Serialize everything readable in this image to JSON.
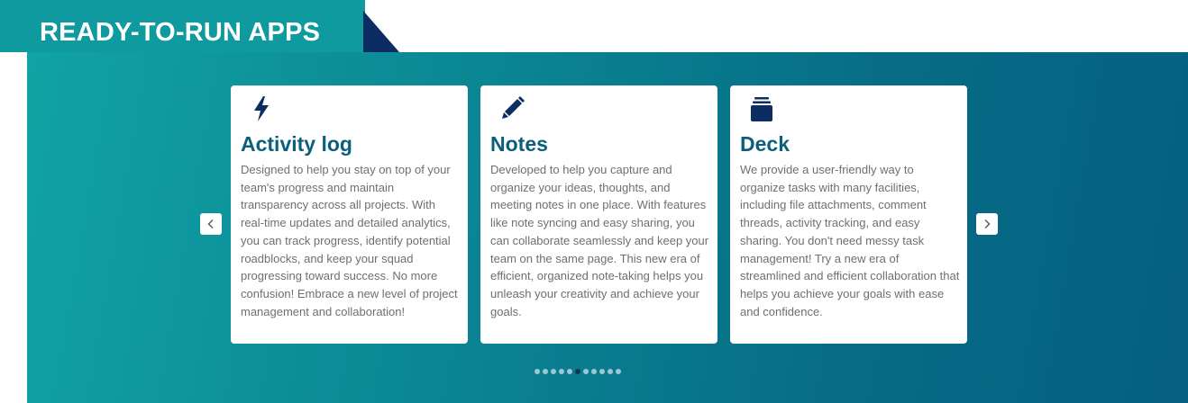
{
  "section": {
    "title": "READY-TO-RUN APPS"
  },
  "cards": [
    {
      "icon": "lightning-bolt-icon",
      "title": "Activity log",
      "description": "Designed to help you stay on top of your team's progress and maintain transparency across all projects. With real-time updates and detailed analytics, you can track progress, identify potential roadblocks, and keep your squad progressing toward success. No more confusion! Embrace a new level of project management and collaboration!"
    },
    {
      "icon": "pencil-icon",
      "title": "Notes",
      "description": "Developed to help you capture and organize your ideas, thoughts, and meeting notes in one place. With features like note syncing and easy sharing, you can collaborate seamlessly and keep your team on the same page. This new era of efficient, organized note-taking helps you unleash your creativity and achieve your goals."
    },
    {
      "icon": "deck-stack-icon",
      "title": "Deck",
      "description": "We provide a user-friendly way to organize tasks with many facilities, including file attachments, comment threads, activity tracking, and easy sharing. You don't need messy task management! Try a new era of streamlined and efficient collaboration that helps you achieve your goals with ease and confidence."
    }
  ],
  "carousel": {
    "prev_icon": "chevron-left-icon",
    "next_icon": "chevron-right-icon",
    "dot_count": 11,
    "active_dot": 5
  },
  "colors": {
    "header_bg": "#0e9a9f",
    "header_notch": "#0c2d63",
    "title_color": "#0c5f7c",
    "band_start": "#11a3a5",
    "band_end": "#055f80"
  }
}
